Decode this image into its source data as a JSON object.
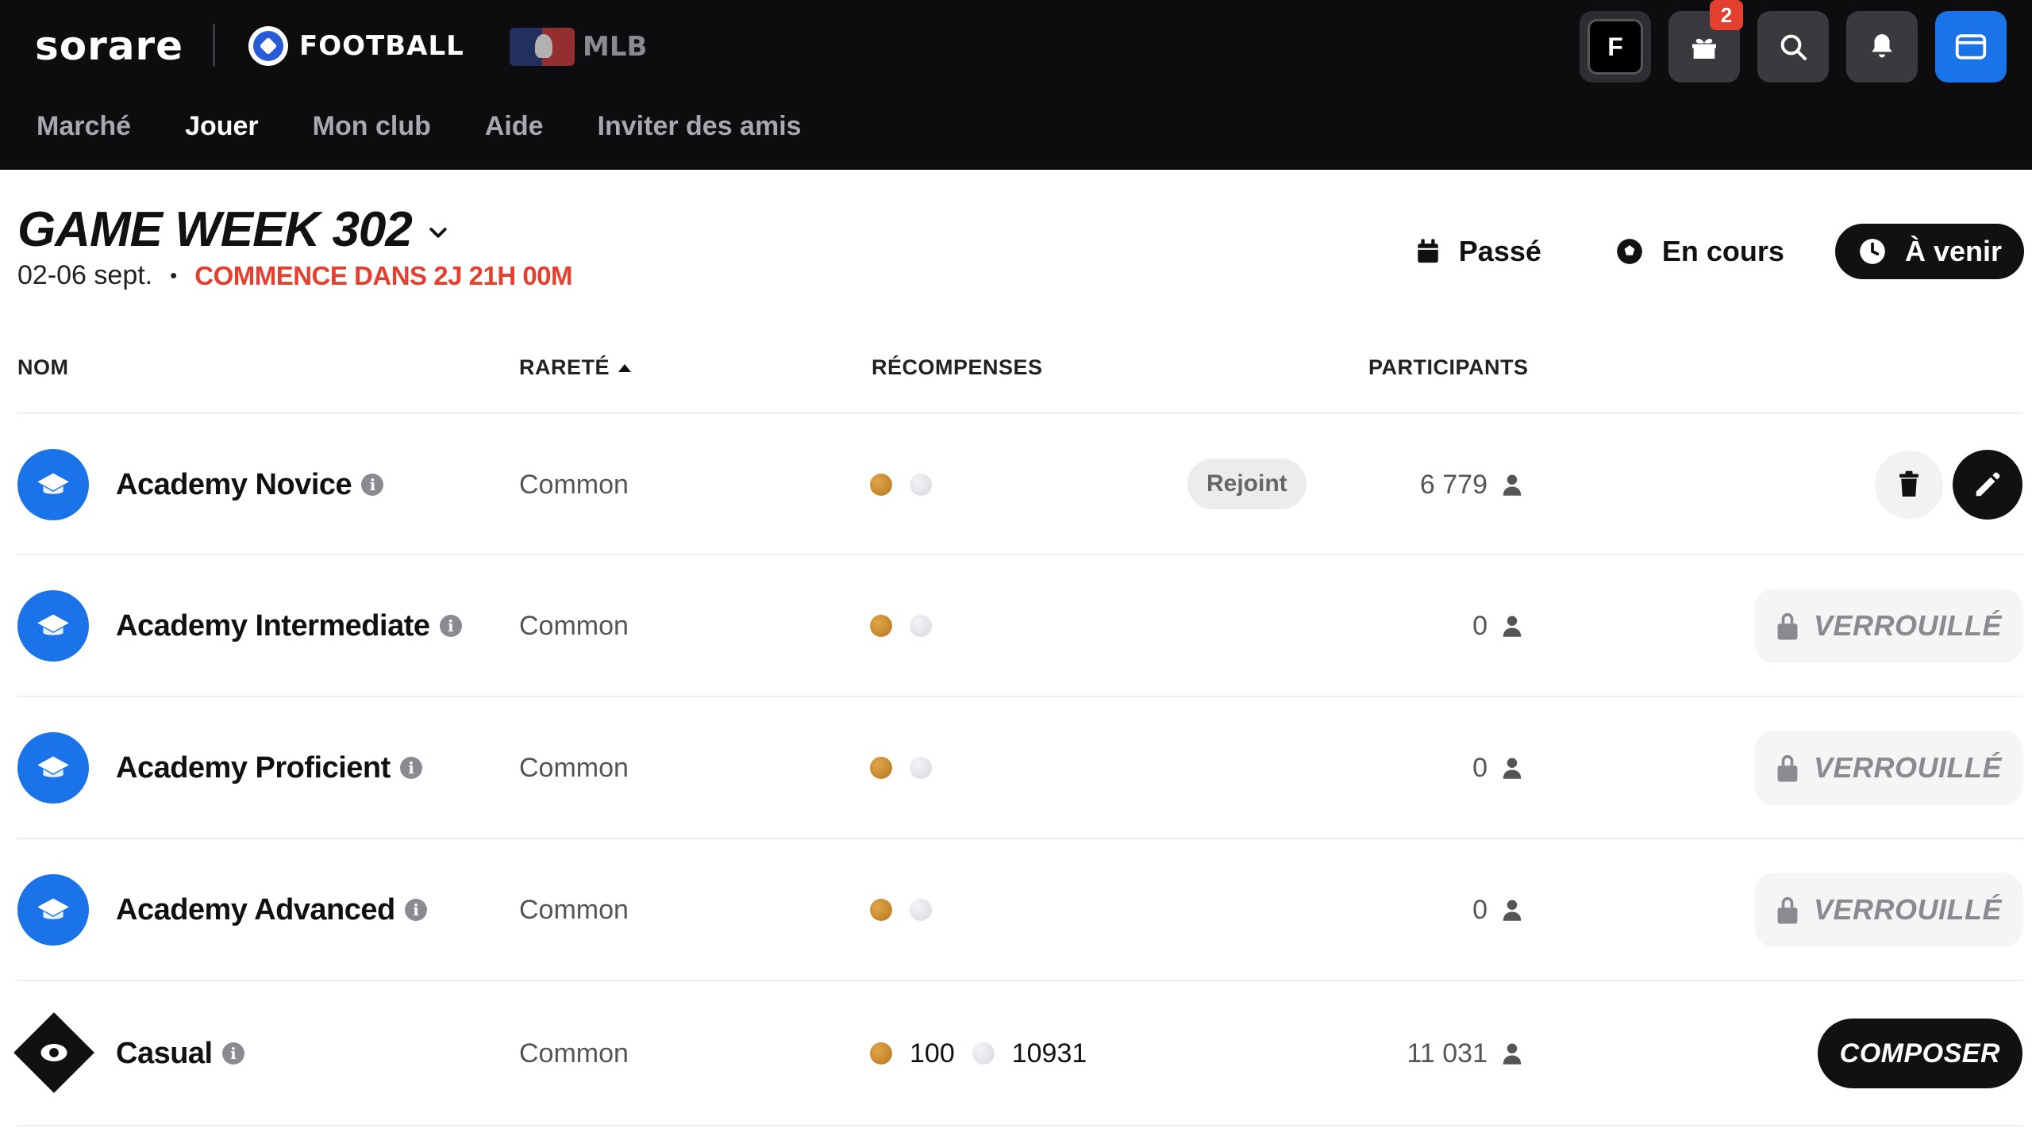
{
  "header": {
    "brand": "sorare",
    "sports": [
      {
        "label": "FOOTBALL",
        "active": true
      },
      {
        "label": "MLB",
        "active": false
      }
    ],
    "avatar_letter": "F",
    "gift_badge": "2",
    "nav": [
      "Marché",
      "Jouer",
      "Mon club",
      "Aide",
      "Inviter des amis"
    ],
    "nav_active": "Jouer"
  },
  "gameweek": {
    "title": "GAME WEEK 302",
    "dates": "02-06 sept.",
    "separator": "•",
    "starts": "COMMENCE DANS 2J 21H 00M"
  },
  "filters": [
    {
      "label": "Passé",
      "icon": "calendar-icon",
      "active": false
    },
    {
      "label": "En cours",
      "icon": "soccer-ball-icon",
      "active": false
    },
    {
      "label": "À venir",
      "icon": "clock-icon",
      "active": true
    }
  ],
  "table": {
    "columns": {
      "name": "NOM",
      "rarity": "RARETÉ",
      "rewards": "RÉCOMPENSES",
      "participants": "PARTICIPANTS"
    },
    "rows": [
      {
        "name": "Academy Novice",
        "rarity": "Common",
        "reward_gold": "",
        "reward_silver": "",
        "status": "Rejoint",
        "participants": "6 779",
        "action": "edit"
      },
      {
        "name": "Academy Intermediate",
        "rarity": "Common",
        "reward_gold": "",
        "reward_silver": "",
        "status": "",
        "participants": "0",
        "action": "VERROUILLÉ"
      },
      {
        "name": "Academy Proficient",
        "rarity": "Common",
        "reward_gold": "",
        "reward_silver": "",
        "status": "",
        "participants": "0",
        "action": "VERROUILLÉ"
      },
      {
        "name": "Academy Advanced",
        "rarity": "Common",
        "reward_gold": "",
        "reward_silver": "",
        "status": "",
        "participants": "0",
        "action": "VERROUILLÉ"
      },
      {
        "name": "Casual",
        "rarity": "Common",
        "reward_gold": "100",
        "reward_silver": "10931",
        "status": "",
        "participants": "11 031",
        "action": "COMPOSER"
      }
    ]
  },
  "colors": {
    "topbar": "#0d0d0f",
    "accent_blue": "#1a73e8",
    "alert_red": "#e3402f",
    "coin_gold": "#c98a2e",
    "coin_silver": "#e2e4e8"
  }
}
